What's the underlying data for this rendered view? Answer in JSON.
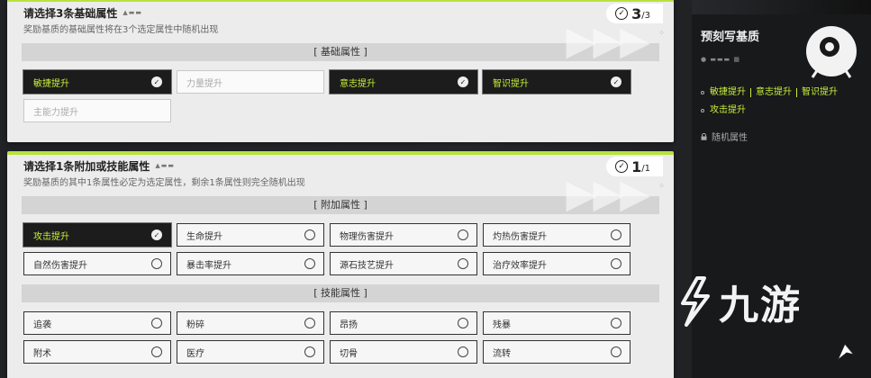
{
  "panel1": {
    "title": "请选择3条基础属性",
    "subtitle": "奖励基质的基础属性将在3个选定属性中随机出现",
    "count_current": "3",
    "count_total": "/3",
    "section_label": "[ 基础属性 ]",
    "options": [
      {
        "label": "敏捷提升",
        "state": "selected"
      },
      {
        "label": "力量提升",
        "state": "disabled"
      },
      {
        "label": "意志提升",
        "state": "selected"
      },
      {
        "label": "智识提升",
        "state": "selected"
      },
      {
        "label": "主能力提升",
        "state": "disabled"
      }
    ]
  },
  "panel2": {
    "title": "请选择1条附加或技能属性",
    "subtitle": "奖励基质的其中1条属性必定为选定属性，剩余1条属性则完全随机出现",
    "count_current": "1",
    "count_total": "/1",
    "section_additional": "[ 附加属性 ]",
    "additional_options": [
      {
        "label": "攻击提升",
        "state": "selected"
      },
      {
        "label": "生命提升",
        "state": "normal"
      },
      {
        "label": "物理伤害提升",
        "state": "normal"
      },
      {
        "label": "灼热伤害提升",
        "state": "normal"
      },
      {
        "label": "自然伤害提升",
        "state": "normal"
      },
      {
        "label": "暴击率提升",
        "state": "normal"
      },
      {
        "label": "源石技艺提升",
        "state": "normal"
      },
      {
        "label": "治疗效率提升",
        "state": "normal"
      }
    ],
    "section_skill": "[ 技能属性 ]",
    "skill_options": [
      {
        "label": "追袭",
        "state": "normal"
      },
      {
        "label": "粉碎",
        "state": "normal"
      },
      {
        "label": "昂扬",
        "state": "normal"
      },
      {
        "label": "残暴",
        "state": "normal"
      },
      {
        "label": "附术",
        "state": "normal"
      },
      {
        "label": "医疗",
        "state": "normal"
      },
      {
        "label": "切骨",
        "state": "normal"
      },
      {
        "label": "流转",
        "state": "normal"
      }
    ]
  },
  "sidebar": {
    "title": "预刻写基质",
    "selected_attrs": [
      "敏捷提升",
      "意志提升",
      "智识提升"
    ],
    "selected_attr_2": "攻击提升",
    "random_label": "随机属性"
  },
  "watermark": {
    "text": "九游"
  },
  "colors": {
    "accent": "#c6ef3a",
    "panel_top": "#b9e23a",
    "selected_bg": "#1c1c1c",
    "panel_bg": "#ececec"
  }
}
